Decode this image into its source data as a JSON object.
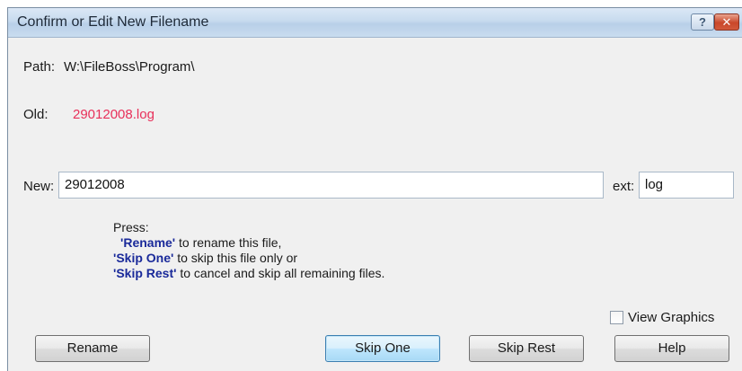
{
  "window": {
    "title": "Confirm or Edit New Filename",
    "help_button": "?",
    "close_button": "✕"
  },
  "path": {
    "label": "Path:",
    "value": "W:\\FileBoss\\Program\\"
  },
  "old": {
    "label": "Old:",
    "value": "29012008.log"
  },
  "new": {
    "label": "New:",
    "value": "29012008"
  },
  "ext": {
    "label": "ext:",
    "value": "log"
  },
  "instructions": {
    "intro": "Press:",
    "rename_kw": "'Rename'",
    "rename_text": " to rename this file,",
    "skipone_kw": "'Skip One'",
    "skipone_text": " to skip this file only or",
    "skiprest_kw": "'Skip Rest'",
    "skiprest_text": " to cancel and skip all remaining files."
  },
  "view_graphics": {
    "label": "View Graphics",
    "checked": false
  },
  "buttons": {
    "rename": "Rename",
    "skip_one": "Skip One",
    "skip_rest": "Skip Rest",
    "help": "Help"
  },
  "colors": {
    "old_value": "#e8305a",
    "keyword": "#1a2a9a",
    "titlebar": "#c7daee"
  }
}
